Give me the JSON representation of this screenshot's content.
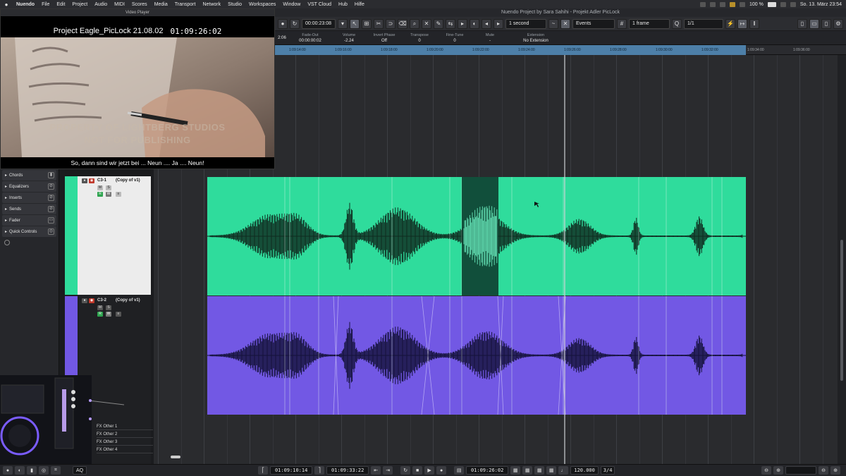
{
  "menubar": {
    "app": "Nuendo",
    "items": [
      "File",
      "Edit",
      "Project",
      "Audio",
      "MIDI",
      "Scores",
      "Media",
      "Transport",
      "Network",
      "Studio",
      "Workspaces",
      "Window",
      "VST Cloud",
      "Hub",
      "Hilfe"
    ],
    "battery": "100 %",
    "datetime": "So. 13. März  23:54"
  },
  "window": {
    "title": "Nuendo Project by Sara Sahihi - Projekt Adler PicLock"
  },
  "toolbar": {
    "timecode": "00:00:23:08",
    "nudge": "1 second",
    "snap_mode": "Events",
    "grid": "1 frame",
    "quantize": "1/1"
  },
  "infoline": {
    "left_value": "2:06",
    "fields": [
      {
        "label": "Fade-Out",
        "value": "00:00:00:02"
      },
      {
        "label": "Volume",
        "value": "-2.24"
      },
      {
        "label": "Invert Phase",
        "value": "Off"
      },
      {
        "label": "Transpose",
        "value": "0"
      },
      {
        "label": "Fine-Tune",
        "value": "0"
      },
      {
        "label": "Mute",
        "value": "-"
      },
      {
        "label": "Extension",
        "value": "No Extension"
      }
    ]
  },
  "ruler": {
    "ticks": [
      "1:09:14:00",
      "1:09:16:00",
      "1:09:18:00",
      "1:09:20:00",
      "1:09:22:00",
      "1:09:24:00",
      "1:09:26:00",
      "1:09:28:00",
      "1:09:30:00",
      "1:09:32:00",
      "1:09:34:00",
      "1:09:36:00"
    ]
  },
  "inspector": {
    "rows": [
      "Chords",
      "Equalizers",
      "Inserts",
      "Sends",
      "Fader",
      "Quick Controls"
    ]
  },
  "tracks": [
    {
      "name": "C3-1",
      "copy_label": "(Copy of v1)",
      "color": "#2fdc9c"
    },
    {
      "name": "C3-2",
      "copy_label": "(Copy of v1)",
      "color": "#7258e4"
    }
  ],
  "video": {
    "window_title": "Video Player",
    "overlay_title": "Project Eagle_PicLock 21.08.02",
    "overlay_timecode": "01:09:26:02",
    "watermark_line1": "PROPERTY OF LIGHTBERG STUDIOS",
    "watermark_line2": "NOT FOR PUBLISHING",
    "subtitle": "So, dann sind wir jetzt bei ... Neun .... Ja .... Neun!"
  },
  "fx_lanes": [
    "FX Other 1",
    "FX Other 2",
    "FX Other 3",
    "FX Other 4"
  ],
  "transport": {
    "left_locator": "01:09:10:14",
    "right_locator": "01:09:33:22",
    "position": "01:09:26:02",
    "tempo": "120.000",
    "signature": "3/4"
  },
  "colors": {
    "green_clip": "#2fdc9c",
    "purple_clip": "#7258e4",
    "ruler_band": "#4d7fa8",
    "background": "#2a2b2e"
  }
}
